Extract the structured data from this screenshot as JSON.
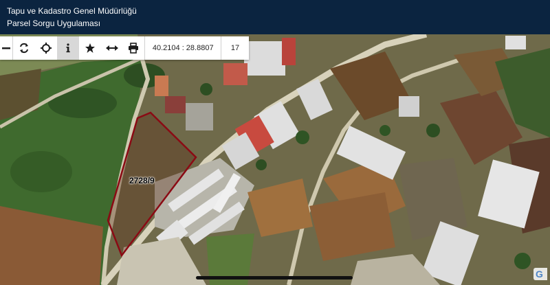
{
  "header": {
    "title": "Tapu ve Kadastro Genel Müdürlüğü",
    "subtitle": "Parsel Sorgu Uygulaması"
  },
  "toolbar": {
    "tools": [
      {
        "icon": "zoom-out-icon",
        "active": false
      },
      {
        "icon": "refresh-icon",
        "active": false
      },
      {
        "icon": "locate-icon",
        "active": false
      },
      {
        "icon": "info-icon",
        "active": true
      },
      {
        "icon": "star-icon",
        "active": false
      },
      {
        "icon": "measure-icon",
        "active": false
      },
      {
        "icon": "print-icon",
        "active": false
      }
    ],
    "coordinates": "40.2104 : 28.8807",
    "zoom_level": "17"
  },
  "map": {
    "parcel_label": "2728/9",
    "parcel_outline_color": "#8b0a14",
    "attribution_logo": "G"
  }
}
